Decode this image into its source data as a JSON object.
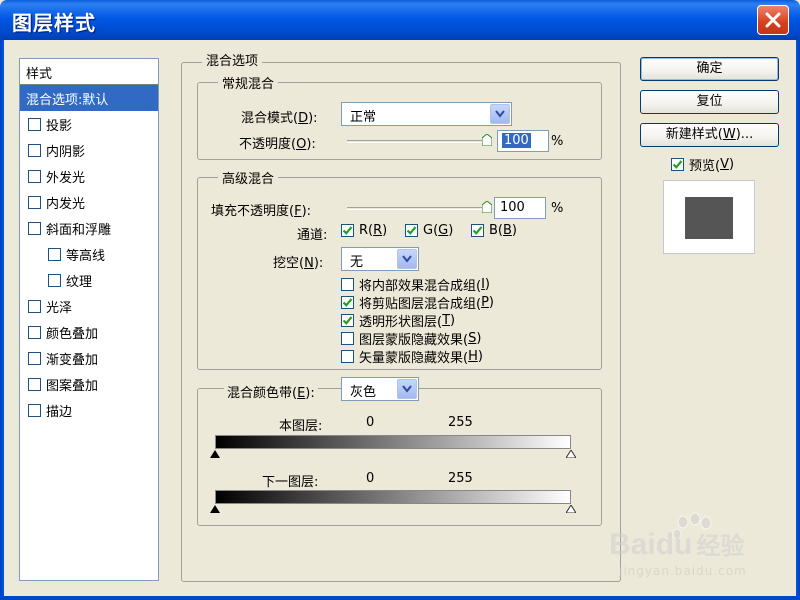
{
  "window": {
    "title": "图层样式"
  },
  "style_list": {
    "header": "样式",
    "items": [
      {
        "label": "混合选项:默认",
        "selected": true,
        "checkbox": false,
        "indent": false
      },
      {
        "label": "投影",
        "checkbox": true,
        "indent": false
      },
      {
        "label": "内阴影",
        "checkbox": true,
        "indent": false
      },
      {
        "label": "外发光",
        "checkbox": true,
        "indent": false
      },
      {
        "label": "内发光",
        "checkbox": true,
        "indent": false
      },
      {
        "label": "斜面和浮雕",
        "checkbox": true,
        "indent": false
      },
      {
        "label": "等高线",
        "checkbox": true,
        "indent": true
      },
      {
        "label": "纹理",
        "checkbox": true,
        "indent": true
      },
      {
        "label": "光泽",
        "checkbox": true,
        "indent": false
      },
      {
        "label": "颜色叠加",
        "checkbox": true,
        "indent": false
      },
      {
        "label": "渐变叠加",
        "checkbox": true,
        "indent": false
      },
      {
        "label": "图案叠加",
        "checkbox": true,
        "indent": false
      },
      {
        "label": "描边",
        "checkbox": true,
        "indent": false
      }
    ]
  },
  "blend_options": {
    "title": "混合选项",
    "general": {
      "title": "常规混合",
      "mode_label": "混合模式(",
      "mode_key": "D",
      "mode_value": "正常",
      "opacity_label": "不透明度(",
      "opacity_key": "O",
      "opacity_value": "100",
      "opacity_level": 1.0,
      "percent": "%"
    },
    "advanced": {
      "title": "高级混合",
      "fill_label": "填充不透明度(",
      "fill_key": "F",
      "fill_value": "100",
      "fill_level": 1.0,
      "percent": "%",
      "channels_label": "通道:",
      "channels": [
        {
          "label": "R(",
          "key": "R",
          "checked": true
        },
        {
          "label": "G(",
          "key": "G",
          "checked": true
        },
        {
          "label": "B(",
          "key": "B",
          "checked": true
        }
      ],
      "knockout_label": "挖空(",
      "knockout_key": "N",
      "knockout_value": "无",
      "options": [
        {
          "label": "将内部效果混合成组(",
          "key": "I",
          "checked": false
        },
        {
          "label": "将剪贴图层混合成组(",
          "key": "P",
          "checked": true
        },
        {
          "label": "透明形状图层(",
          "key": "T",
          "checked": true
        },
        {
          "label": "图层蒙版隐藏效果(",
          "key": "S",
          "checked": false
        },
        {
          "label": "矢量蒙版隐藏效果(",
          "key": "H",
          "checked": false
        }
      ]
    },
    "blend_if": {
      "label": "混合颜色带(",
      "key": "E",
      "value": "灰色",
      "this_layer": {
        "label": "本图层:",
        "min": "0",
        "max": "255"
      },
      "underlying": {
        "label": "下一图层:",
        "min": "0",
        "max": "255"
      }
    }
  },
  "buttons": {
    "ok": "确定",
    "reset": "复位",
    "new_style": "新建样式(",
    "new_style_key": "W",
    "new_style_suffix": ")..."
  },
  "preview": {
    "label": "预览(",
    "key": "V",
    "checked": true
  },
  "watermark": {
    "brand": "Bai",
    "brand2": "du",
    "service": "经验",
    "url": "jingyan.baidu.com"
  },
  "colors": {
    "title_bar": "#0058e6",
    "selection": "#316ac5",
    "dialog_bg": "#ece9d8",
    "check_green": "#21a121"
  }
}
